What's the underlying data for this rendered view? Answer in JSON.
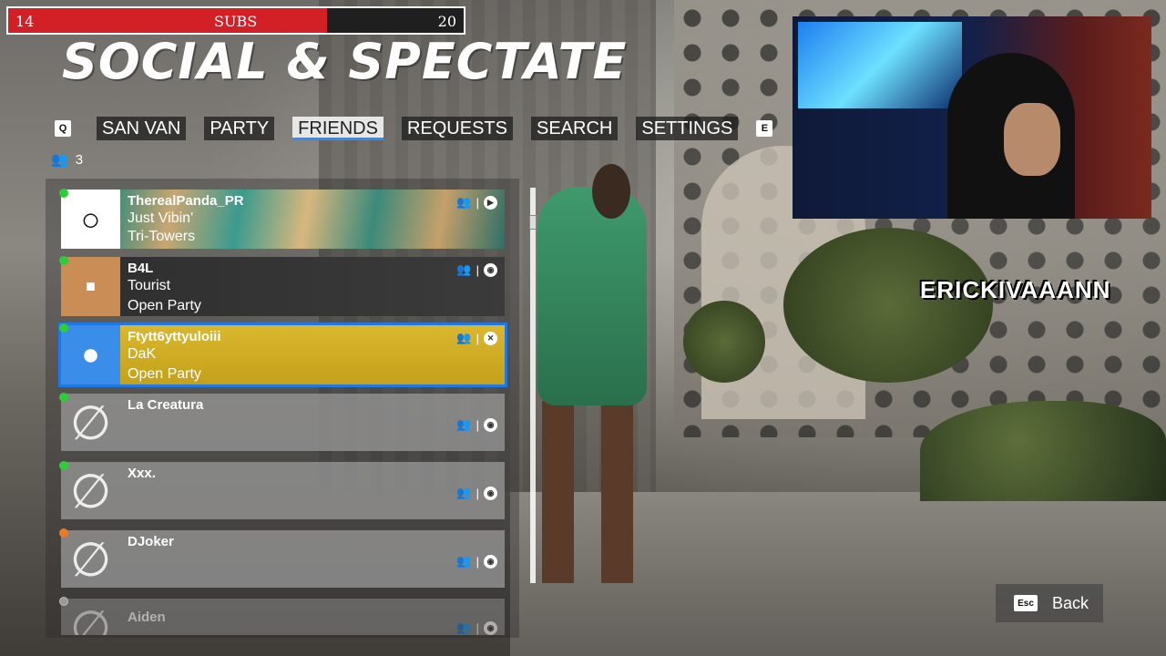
{
  "subs": {
    "left": "14",
    "label": "SUBS",
    "right": "20",
    "progress": 0.7
  },
  "title": "SOCIAL & SPECTATE",
  "tabs": {
    "left_key": "Q",
    "right_key": "E",
    "items": [
      "SAN VAN",
      "PARTY",
      "FRIENDS",
      "REQUESTS",
      "SEARCH",
      "SETTINGS"
    ],
    "active": "FRIENDS"
  },
  "friend_count": "3",
  "friends": [
    {
      "name": "TherealPanda_PR",
      "line1": "Just Vibin'",
      "line2": "Tri-Towers",
      "status": "online",
      "platform": "PS"
    },
    {
      "name": "B4L",
      "line1": "Tourist",
      "line2": "Open Party",
      "status": "online",
      "platform": "Steam"
    },
    {
      "name": "Ftytt6yttyuloiii",
      "line1": "DaK",
      "line2": "Open Party",
      "status": "online",
      "platform": "Xbox"
    },
    {
      "name": "La Creatura",
      "line1": "",
      "line2": "",
      "status": "online",
      "platform": "Steam"
    },
    {
      "name": "Xxx.",
      "line1": "",
      "line2": "",
      "status": "online",
      "platform": "Steam"
    },
    {
      "name": "DJoker",
      "line1": "",
      "line2": "",
      "status": "busy",
      "platform": "Steam"
    },
    {
      "name": "Aiden",
      "line1": "",
      "line2": "",
      "status": "offline",
      "platform": "Steam"
    }
  ],
  "streamer_logo": "ERICKIVAAANN",
  "back": {
    "key": "Esc",
    "label": "Back"
  },
  "colors": {
    "online": "#2fcc3a",
    "busy": "#e87a2a",
    "offline": "#9a9a9a",
    "accent": "#1e78e6",
    "subs_red": "#d32027"
  }
}
